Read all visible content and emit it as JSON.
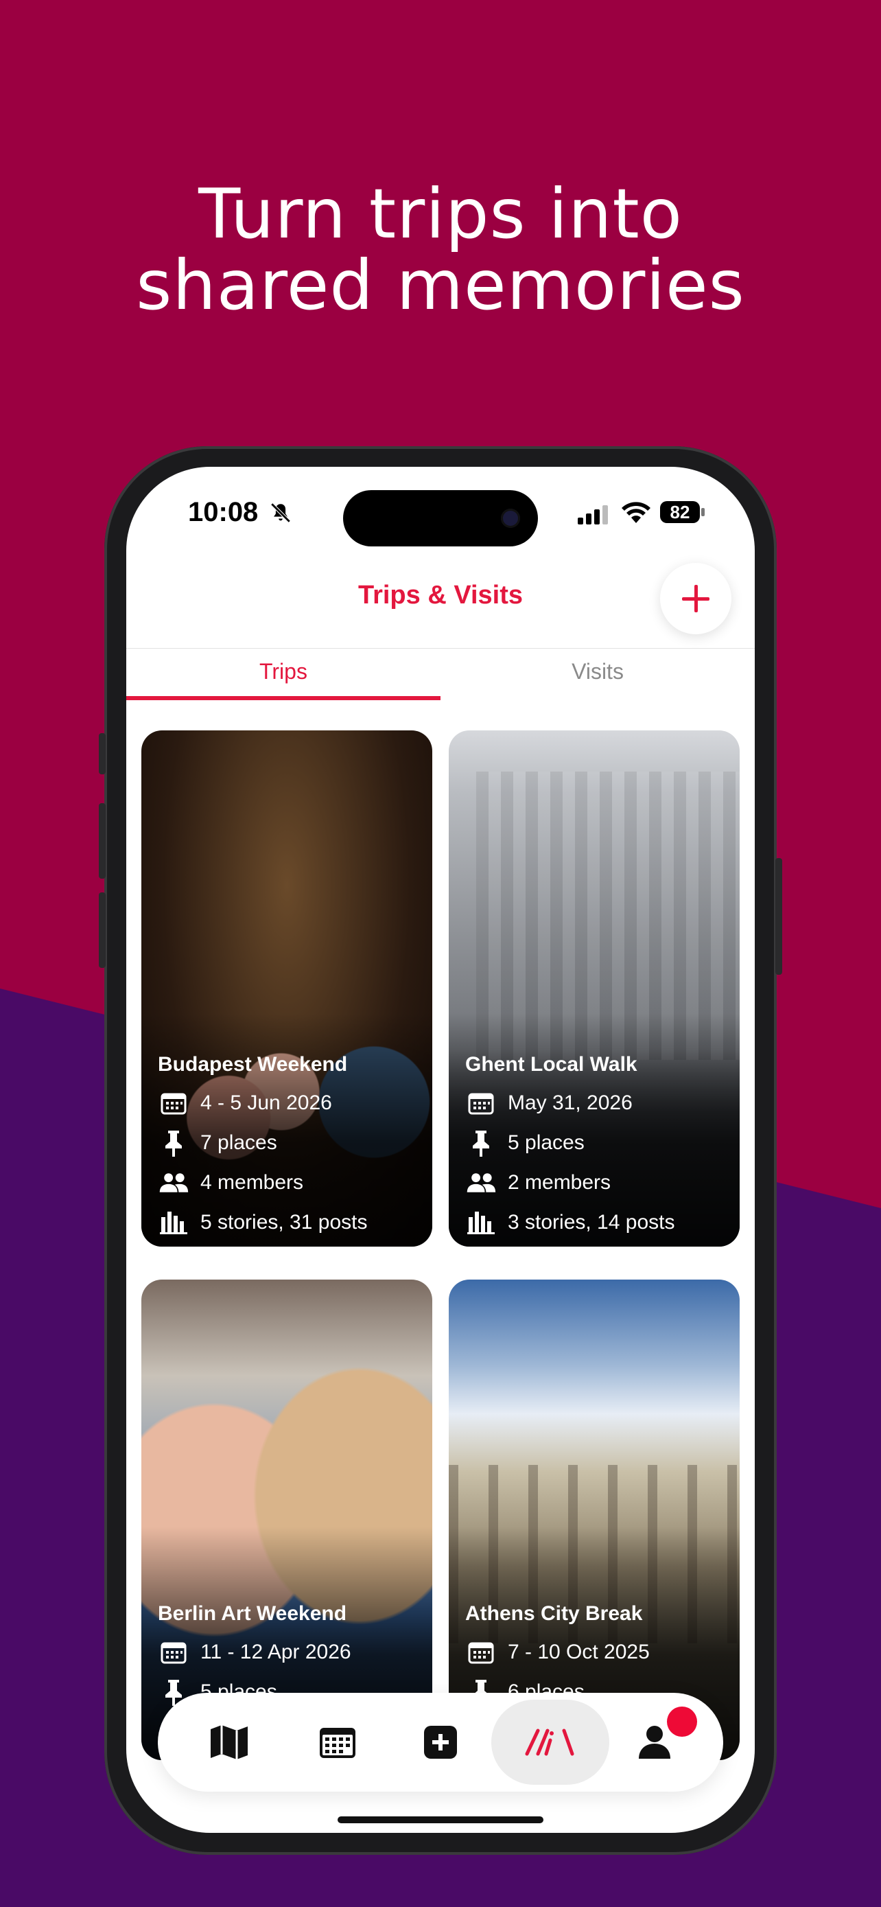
{
  "headline": {
    "line1": "Turn trips into",
    "line2": "shared memories"
  },
  "status_bar": {
    "time": "10:08",
    "battery": "82"
  },
  "nav": {
    "title": "Trips & Visits"
  },
  "tabs": [
    {
      "label": "Trips",
      "selected": true
    },
    {
      "label": "Visits",
      "selected": false
    }
  ],
  "cards": [
    {
      "title": "Budapest Weekend",
      "dates": "4 - 5 Jun 2026",
      "places": "7 places",
      "members": "4 members",
      "stories": "5 stories, 31 posts"
    },
    {
      "title": "Ghent Local Walk",
      "dates": "May 31, 2026",
      "places": "5 places",
      "members": "2 members",
      "stories": "3 stories, 14 posts"
    },
    {
      "title": "Berlin Art Weekend",
      "dates": "11 - 12 Apr 2026",
      "places": "5 places"
    },
    {
      "title": "Athens City Break",
      "dates": "7 - 10 Oct 2025",
      "places": "6 places"
    }
  ],
  "tab_bar": {
    "items": [
      "map-icon",
      "calendar-icon",
      "add-square-icon",
      "app-logo-icon",
      "profile-icon"
    ],
    "active_index": 3
  },
  "colors": {
    "accent": "#e3173e",
    "bg_top": "#9b0041",
    "bg_bottom": "#4a0a66"
  }
}
